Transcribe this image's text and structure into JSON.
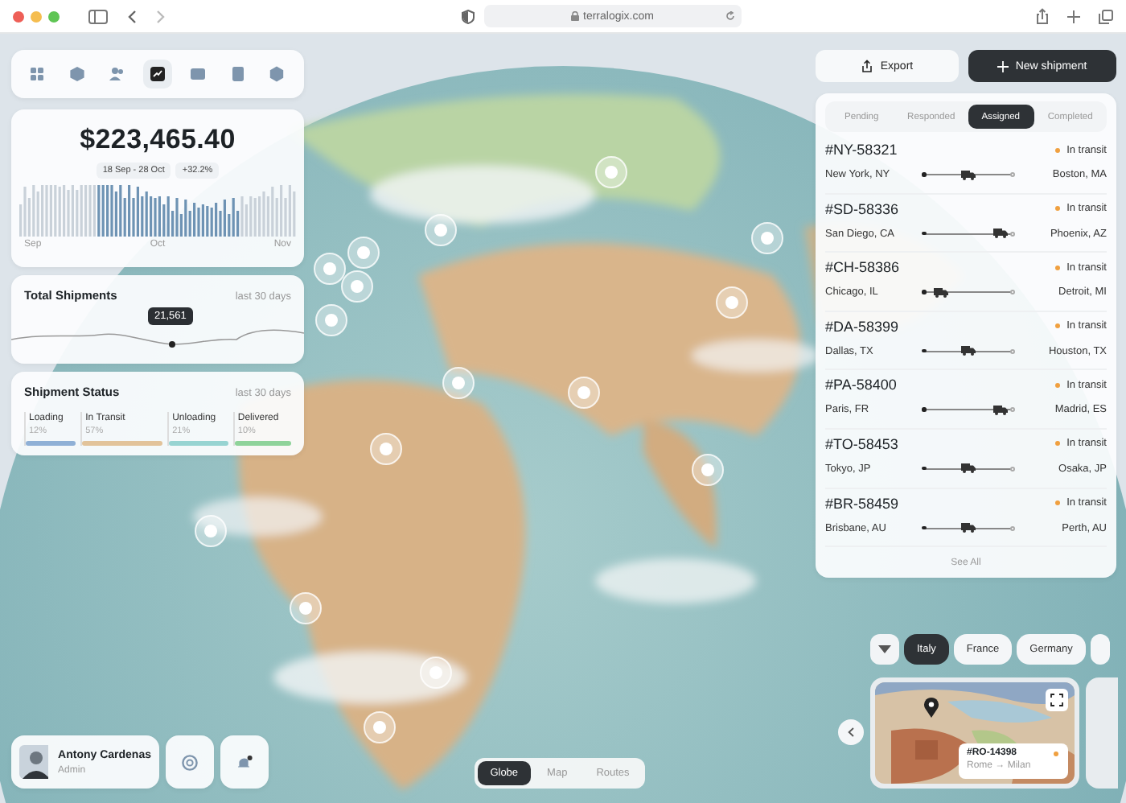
{
  "browser": {
    "url": "terralogix.com"
  },
  "nav": [
    {
      "selected": false
    },
    {
      "selected": false
    },
    {
      "selected": false
    },
    {
      "selected": true
    },
    {
      "selected": false
    },
    {
      "selected": false
    },
    {
      "selected": false
    }
  ],
  "revenue": {
    "amount": "$223,465.40",
    "range": "18 Sep - 28 Oct",
    "change": "+32.2%",
    "axis_labels": [
      "Sep",
      "Oct",
      "Nov"
    ]
  },
  "total_shipments": {
    "title": "Total Shipments",
    "period": "last 30 days",
    "tooltip": "21,561"
  },
  "shipment_status": {
    "title": "Shipment Status",
    "period": "last 30 days",
    "segments": [
      {
        "label": "Loading",
        "share": "12%",
        "color": "#8fb0d6"
      },
      {
        "label": "In Transit",
        "share": "57%",
        "color": "#e2c39a"
      },
      {
        "label": "Unloading",
        "share": "21%",
        "color": "#97d4d2"
      },
      {
        "label": "Delivered",
        "share": "10%",
        "color": "#8fd39a"
      }
    ]
  },
  "actions": {
    "export": "Export",
    "new_shipment": "New shipment"
  },
  "shipments": {
    "tabs": [
      {
        "label": "Pending",
        "selected": false
      },
      {
        "label": "Responded",
        "selected": false
      },
      {
        "label": "Assigned",
        "selected": true
      },
      {
        "label": "Completed",
        "selected": false
      }
    ],
    "rows": [
      {
        "id": "#NY-58321",
        "status": "In transit",
        "color": "#f0a040",
        "from": "New York, NY",
        "to": "Boston, MA",
        "level": 0.5
      },
      {
        "id": "#SD-58336",
        "status": "In transit",
        "color": "#f0a040",
        "from": "San Diego, CA",
        "to": "Phoenix, AZ",
        "level": 0.85
      },
      {
        "id": "#CH-58386",
        "status": "In transit",
        "color": "#f0a040",
        "from": "Chicago, IL",
        "to": "Detroit, MI",
        "level": 0.2
      },
      {
        "id": "#DA-58399",
        "status": "In transit",
        "color": "#f0a040",
        "from": "Dallas, TX",
        "to": "Houston, TX",
        "level": 0.5
      },
      {
        "id": "#PA-58400",
        "status": "In transit",
        "color": "#f0a040",
        "from": "Paris, FR",
        "to": "Madrid, ES",
        "level": 0.85
      },
      {
        "id": "#TO-58453",
        "status": "In transit",
        "color": "#f0a040",
        "from": "Tokyo, JP",
        "to": "Osaka, JP",
        "level": 0.5
      },
      {
        "id": "#BR-58459",
        "status": "In transit",
        "color": "#f0a040",
        "from": "Brisbane, AU",
        "to": "Perth, AU",
        "level": 0.5
      }
    ],
    "see_all": "See All"
  },
  "countries": [
    {
      "label": "Italy",
      "selected": true
    },
    {
      "label": "France",
      "selected": false
    },
    {
      "label": "Germany",
      "selected": false
    }
  ],
  "map_card": {
    "id": "#RO-14398",
    "route": "Rome → Milan",
    "color": "#f0a040"
  },
  "user": {
    "name": "Antony Cardenas",
    "role": "Admin"
  },
  "views": [
    {
      "label": "Globe",
      "selected": true
    },
    {
      "label": "Map",
      "selected": false
    },
    {
      "label": "Routes",
      "selected": false
    }
  ]
}
